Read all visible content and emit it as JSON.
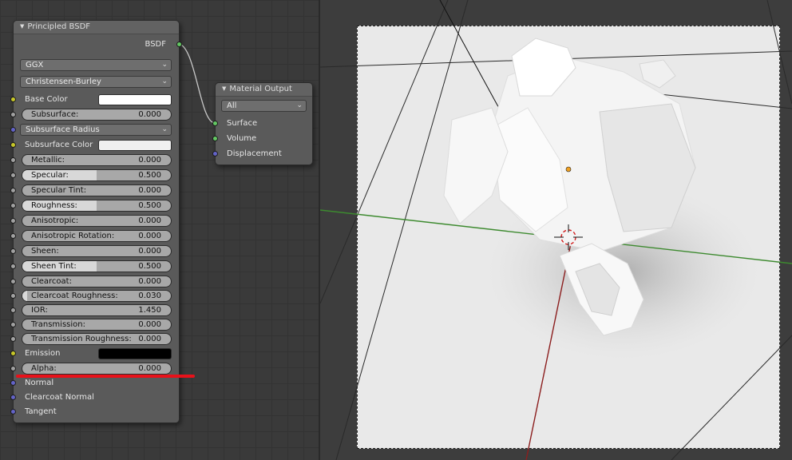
{
  "principled": {
    "title": "Principled BSDF",
    "output_label": "BSDF",
    "distribution": "GGX",
    "subsurface_method": "Christensen-Burley",
    "base_color_label": "Base Color",
    "subsurface_label": "Subsurface:",
    "subsurface_value": "0.000",
    "subsurface_radius_label": "Subsurface Radius",
    "subsurface_color_label": "Subsurface Color",
    "sliders": [
      {
        "label": "Metallic:",
        "value": "0.000",
        "fraction": 0.0
      },
      {
        "label": "Specular:",
        "value": "0.500",
        "fraction": 0.5
      },
      {
        "label": "Specular Tint:",
        "value": "0.000",
        "fraction": 0.0
      },
      {
        "label": "Roughness:",
        "value": "0.500",
        "fraction": 0.5
      },
      {
        "label": "Anisotropic:",
        "value": "0.000",
        "fraction": 0.0
      },
      {
        "label": "Anisotropic Rotation:",
        "value": "0.000",
        "fraction": 0.0
      },
      {
        "label": "Sheen:",
        "value": "0.000",
        "fraction": 0.0
      },
      {
        "label": "Sheen Tint:",
        "value": "0.500",
        "fraction": 0.5
      },
      {
        "label": "Clearcoat:",
        "value": "0.000",
        "fraction": 0.0
      },
      {
        "label": "Clearcoat Roughness:",
        "value": "0.030",
        "fraction": 0.03
      },
      {
        "label": "IOR:",
        "value": "1.450",
        "fraction": 0.0
      },
      {
        "label": "Transmission:",
        "value": "0.000",
        "fraction": 0.0
      },
      {
        "label": "Transmission Roughness:",
        "value": "0.000",
        "fraction": 0.0
      }
    ],
    "emission_label": "Emission",
    "alpha_label": "Alpha:",
    "alpha_value": "0.000",
    "normal_label": "Normal",
    "clearcoat_normal_label": "Clearcoat Normal",
    "tangent_label": "Tangent",
    "colors": {
      "base": "#ffffff",
      "subsurface": "#f0f0f0",
      "emission": "#000000"
    }
  },
  "material_output": {
    "title": "Material Output",
    "target": "All",
    "surface_label": "Surface",
    "volume_label": "Volume",
    "displacement_label": "Displacement"
  },
  "annotation": {
    "underline_color": "#e8111a"
  }
}
